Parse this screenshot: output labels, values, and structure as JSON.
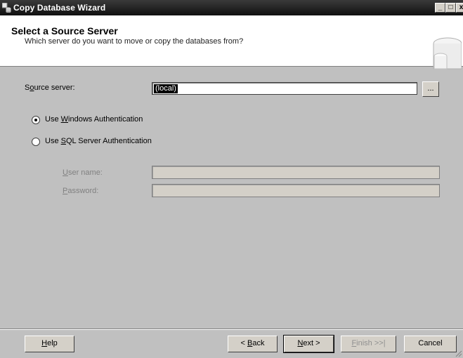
{
  "window": {
    "title": "Copy Database Wizard",
    "controls": [
      "_",
      "□",
      "x"
    ]
  },
  "header": {
    "title": "Select a Source Server",
    "subtitle": "Which server do you want to move or copy the databases from?"
  },
  "source_server": {
    "label_pre": "S",
    "label_acc": "o",
    "label_post": "urce server:",
    "value": "(local)",
    "browse_label": "..."
  },
  "auth": {
    "windows": {
      "pre": "Use ",
      "acc": "W",
      "post": "indows Authentication",
      "selected": true
    },
    "sql": {
      "pre": "Use ",
      "acc": "S",
      "post": "QL Server Authentication",
      "selected": false
    }
  },
  "credentials": {
    "username_acc": "U",
    "username_post": "ser name:",
    "password_acc": "P",
    "password_post": "assword:",
    "username_value": "",
    "password_value": ""
  },
  "footer": {
    "help": {
      "acc": "H",
      "post": "elp"
    },
    "back": {
      "pre": "< ",
      "acc": "B",
      "post": "ack"
    },
    "next": {
      "acc": "N",
      "post": "ext >"
    },
    "finish": {
      "acc": "F",
      "post": "inish >>|"
    },
    "cancel": "Cancel"
  }
}
